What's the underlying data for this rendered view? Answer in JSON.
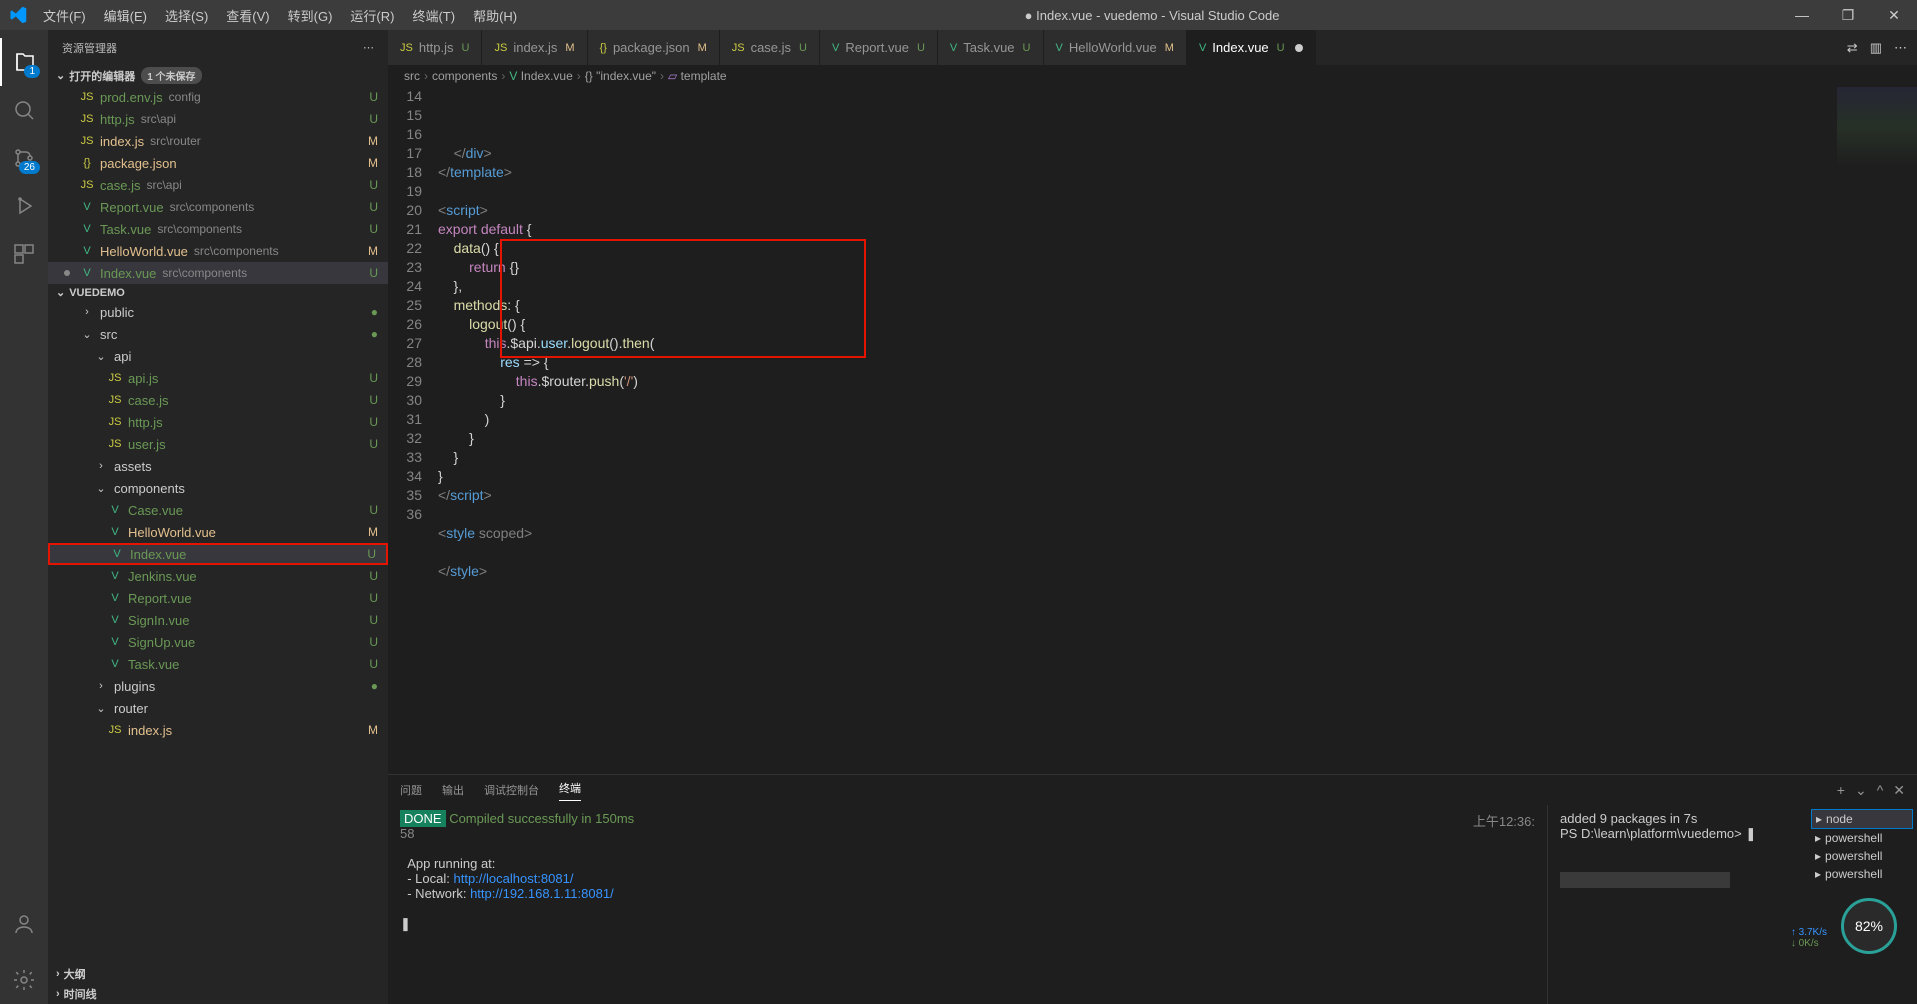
{
  "titlebar": {
    "title": "● Index.vue - vuedemo - Visual Studio Code",
    "menu": [
      "文件(F)",
      "编辑(E)",
      "选择(S)",
      "查看(V)",
      "转到(G)",
      "运行(R)",
      "终端(T)",
      "帮助(H)"
    ]
  },
  "activitybar": {
    "explorer_badge": "1",
    "scm_badge": "26"
  },
  "sidebar": {
    "title": "资源管理器",
    "open_editors": {
      "label": "打开的编辑器",
      "unsaved": "1 个未保存"
    },
    "editors": [
      {
        "icon": "JS",
        "name": "prod.env.js",
        "path": "config",
        "status": "U",
        "cls": "unt",
        "iconcls": "js-i"
      },
      {
        "icon": "JS",
        "name": "http.js",
        "path": "src\\api",
        "status": "U",
        "cls": "unt",
        "iconcls": "js-i"
      },
      {
        "icon": "JS",
        "name": "index.js",
        "path": "src\\router",
        "status": "M",
        "cls": "mod",
        "iconcls": "js-i"
      },
      {
        "icon": "{}",
        "name": "package.json",
        "path": "",
        "status": "M",
        "cls": "mod",
        "iconcls": "json-i"
      },
      {
        "icon": "JS",
        "name": "case.js",
        "path": "src\\api",
        "status": "U",
        "cls": "unt",
        "iconcls": "js-i"
      },
      {
        "icon": "V",
        "name": "Report.vue",
        "path": "src\\components",
        "status": "U",
        "cls": "unt",
        "iconcls": "vue-i"
      },
      {
        "icon": "V",
        "name": "Task.vue",
        "path": "src\\components",
        "status": "U",
        "cls": "unt",
        "iconcls": "vue-i"
      },
      {
        "icon": "V",
        "name": "HelloWorld.vue",
        "path": "src\\components",
        "status": "M",
        "cls": "mod",
        "iconcls": "vue-i"
      },
      {
        "icon": "V",
        "name": "Index.vue",
        "path": "src\\components",
        "status": "U",
        "cls": "unt",
        "iconcls": "vue-i",
        "dot": true,
        "selected": true
      }
    ],
    "project": "VUEDEMO",
    "tree": [
      {
        "chev": "›",
        "name": "public",
        "pad": "indent1",
        "dot": true
      },
      {
        "chev": "⌄",
        "name": "src",
        "pad": "indent1",
        "dot": true
      },
      {
        "chev": "⌄",
        "name": "api",
        "pad": "indent2"
      },
      {
        "icon": "JS",
        "name": "api.js",
        "pad": "indent3",
        "status": "U",
        "cls": "unt",
        "iconcls": "js-i"
      },
      {
        "icon": "JS",
        "name": "case.js",
        "pad": "indent3",
        "status": "U",
        "cls": "unt",
        "iconcls": "js-i"
      },
      {
        "icon": "JS",
        "name": "http.js",
        "pad": "indent3",
        "status": "U",
        "cls": "unt",
        "iconcls": "js-i"
      },
      {
        "icon": "JS",
        "name": "user.js",
        "pad": "indent3",
        "status": "U",
        "cls": "unt",
        "iconcls": "js-i"
      },
      {
        "chev": "›",
        "name": "assets",
        "pad": "indent2"
      },
      {
        "chev": "⌄",
        "name": "components",
        "pad": "indent2"
      },
      {
        "icon": "V",
        "name": "Case.vue",
        "pad": "indent3",
        "status": "U",
        "cls": "unt",
        "iconcls": "vue-i"
      },
      {
        "icon": "V",
        "name": "HelloWorld.vue",
        "pad": "indent3",
        "status": "M",
        "cls": "mod",
        "iconcls": "vue-i"
      },
      {
        "icon": "V",
        "name": "Index.vue",
        "pad": "indent3",
        "status": "U",
        "cls": "unt",
        "iconcls": "vue-i",
        "selected": true,
        "redbox": true
      },
      {
        "icon": "V",
        "name": "Jenkins.vue",
        "pad": "indent3",
        "status": "U",
        "cls": "unt",
        "iconcls": "vue-i"
      },
      {
        "icon": "V",
        "name": "Report.vue",
        "pad": "indent3",
        "status": "U",
        "cls": "unt",
        "iconcls": "vue-i"
      },
      {
        "icon": "V",
        "name": "SignIn.vue",
        "pad": "indent3",
        "status": "U",
        "cls": "unt",
        "iconcls": "vue-i"
      },
      {
        "icon": "V",
        "name": "SignUp.vue",
        "pad": "indent3",
        "status": "U",
        "cls": "unt",
        "iconcls": "vue-i"
      },
      {
        "icon": "V",
        "name": "Task.vue",
        "pad": "indent3",
        "status": "U",
        "cls": "unt",
        "iconcls": "vue-i"
      },
      {
        "chev": "›",
        "name": "plugins",
        "pad": "indent2",
        "dot": true
      },
      {
        "chev": "⌄",
        "name": "router",
        "pad": "indent2"
      },
      {
        "icon": "JS",
        "name": "index.js",
        "pad": "indent3",
        "status": "M",
        "cls": "mod",
        "iconcls": "js-i"
      }
    ],
    "outline": "大纲",
    "timeline": "时间线"
  },
  "tabs": [
    {
      "icon": "JS",
      "name": "http.js",
      "status": "U",
      "iconcls": "js-i"
    },
    {
      "icon": "JS",
      "name": "index.js",
      "status": "M",
      "iconcls": "js-i"
    },
    {
      "icon": "{}",
      "name": "package.json",
      "status": "M",
      "iconcls": "json-i"
    },
    {
      "icon": "JS",
      "name": "case.js",
      "status": "U",
      "iconcls": "js-i"
    },
    {
      "icon": "V",
      "name": "Report.vue",
      "status": "U",
      "iconcls": "vue-i"
    },
    {
      "icon": "V",
      "name": "Task.vue",
      "status": "U",
      "iconcls": "vue-i"
    },
    {
      "icon": "V",
      "name": "HelloWorld.vue",
      "status": "M",
      "iconcls": "vue-i"
    },
    {
      "icon": "V",
      "name": "Index.vue",
      "status": "U",
      "iconcls": "vue-i",
      "active": true,
      "dot": true
    }
  ],
  "breadcrumb": [
    "src",
    "components",
    "Index.vue",
    "\"index.vue\"",
    "template"
  ],
  "code": {
    "start": 14,
    "lines": [
      "    </div>",
      "</template>",
      "",
      "<script>",
      "export default {",
      "    data() {",
      "        return {}",
      "    },",
      "    methods: {",
      "        logout() {",
      "            this.$api.user.logout().then(",
      "                res => {",
      "                    this.$router.push('/')",
      "                }",
      "            )",
      "        }",
      "    }",
      "}",
      "</script>",
      "",
      "<style scoped>",
      "",
      "</style>"
    ]
  },
  "panel": {
    "tabs": [
      "问题",
      "输出",
      "调试控制台",
      "终端"
    ],
    "active": 3,
    "done": "DONE",
    "compile": "Compiled successfully in 150ms",
    "ts": "上午12:36:",
    "line58": "58",
    "running": "App running at:",
    "local_lbl": "- Local:   ",
    "local_url": "http://localhost:8081/",
    "net_lbl": "- Network: ",
    "net_url": "http://192.168.1.11:8081/",
    "cursor": "❚",
    "right1": "added 9 packages in 7s",
    "right2": "PS D:\\learn\\platform\\vuedemo> ❚",
    "termlist": [
      "node",
      "powershell",
      "powershell",
      "powershell"
    ],
    "stats_pct": "82%",
    "stats_up": "↑ 3.7K/s",
    "stats_dn": "↓ 0K/s"
  }
}
